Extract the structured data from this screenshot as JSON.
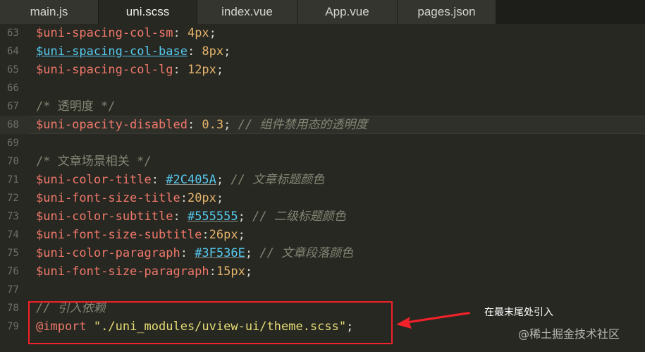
{
  "tabs": [
    {
      "label": "main.js"
    },
    {
      "label": "uni.scss"
    },
    {
      "label": "index.vue"
    },
    {
      "label": "App.vue"
    },
    {
      "label": "pages.json"
    }
  ],
  "lines": [
    {
      "num": "63",
      "var": "$uni-spacing-col-sm",
      "sep": ": ",
      "value": "4px",
      "end": ";"
    },
    {
      "num": "64",
      "var": "$uni-spacing-col-base",
      "sep": ": ",
      "value": "8px",
      "end": ";"
    },
    {
      "num": "65",
      "var": "$uni-spacing-col-lg",
      "sep": ": ",
      "value": "12px",
      "end": ";"
    },
    {
      "num": "66"
    },
    {
      "num": "67",
      "comment": "/* 透明度 */"
    },
    {
      "num": "68",
      "var": "$uni-opacity-disabled",
      "sep": ": ",
      "value": "0.3",
      "end": "; ",
      "trail_comment": "// 组件禁用态的透明度"
    },
    {
      "num": "69"
    },
    {
      "num": "70",
      "comment": "/* 文章场景相关 */"
    },
    {
      "num": "71",
      "var": "$uni-color-title",
      "sep": ": ",
      "value": "#2C405A",
      "end": "; ",
      "trail_comment": "// 文章标题颜色"
    },
    {
      "num": "72",
      "var": "$uni-font-size-title",
      "sep": ":",
      "value": "20px",
      "end": ";"
    },
    {
      "num": "73",
      "var": "$uni-color-subtitle",
      "sep": ": ",
      "value": "#555555",
      "end": "; ",
      "trail_comment": "// 二级标题颜色"
    },
    {
      "num": "74",
      "var": "$uni-font-size-subtitle",
      "sep": ":",
      "value": "26px",
      "end": ";"
    },
    {
      "num": "75",
      "var": "$uni-color-paragraph",
      "sep": ": ",
      "value": "#3F536E",
      "end": "; ",
      "trail_comment": "// 文章段落颜色"
    },
    {
      "num": "76",
      "var": "$uni-font-size-paragraph",
      "sep": ":",
      "value": "15px",
      "end": ";"
    },
    {
      "num": "77"
    },
    {
      "num": "78",
      "comment": "// 引入依赖"
    },
    {
      "num": "79",
      "at": "@import",
      "str": " \"./uni_modules/uview-ui/theme.scss\"",
      "end": ";"
    }
  ],
  "annotation": "在最末尾处引入",
  "watermark": "@稀土掘金技术社区",
  "colors": {
    "highlight": "#f2212a",
    "background": "#272822"
  }
}
